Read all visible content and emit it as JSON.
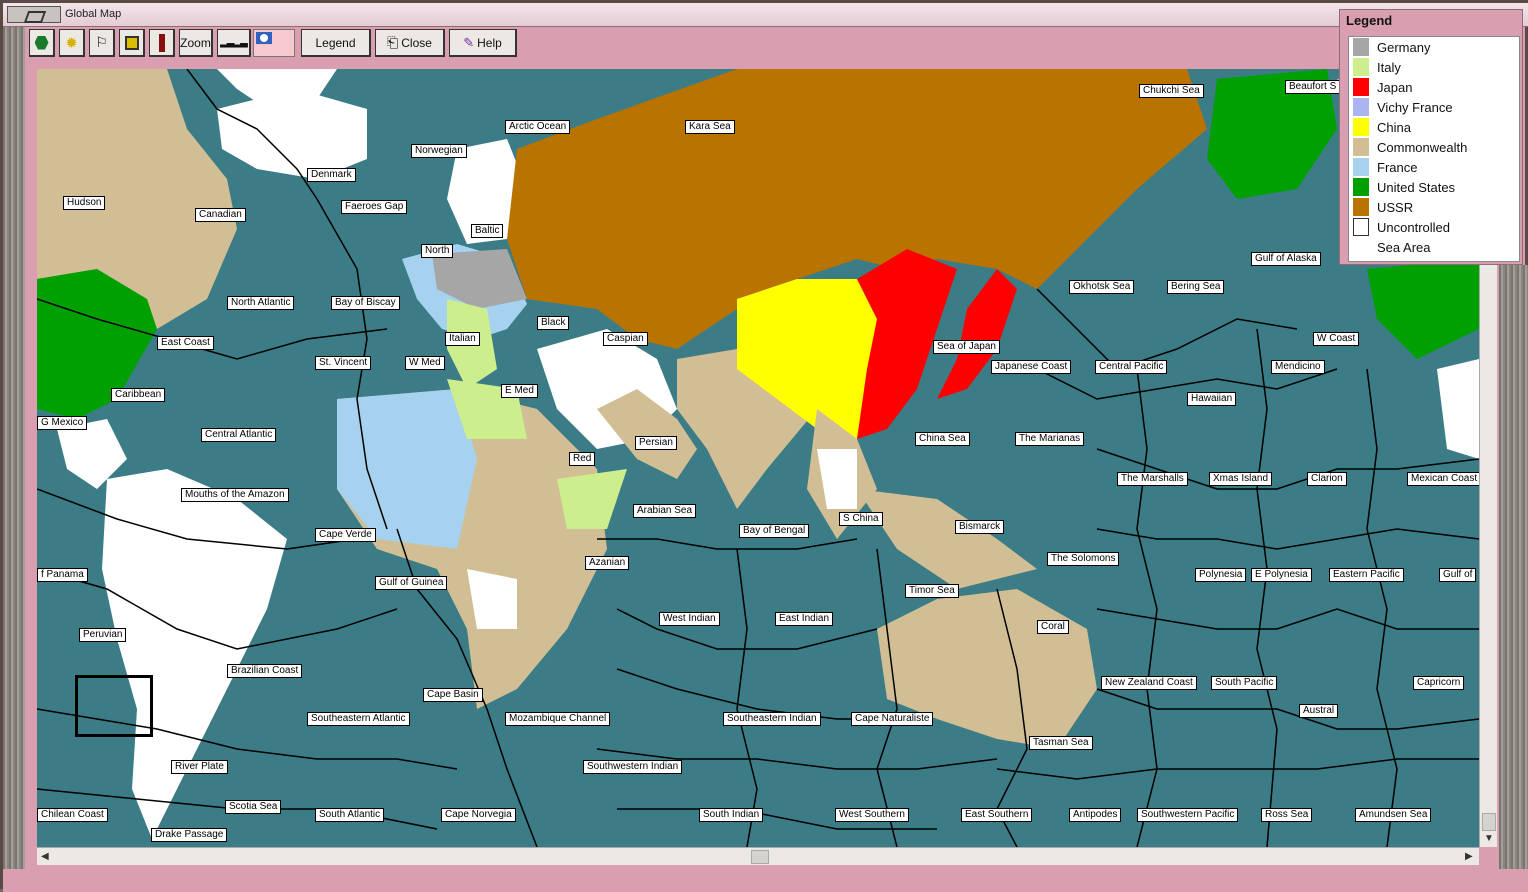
{
  "window": {
    "title": "Global Map"
  },
  "toolbar": {
    "zoom": "Zoom",
    "legend": "Legend",
    "close": "Close",
    "help": "Help"
  },
  "legend": {
    "title": "Legend",
    "items": [
      {
        "label": "Germany",
        "color": "#a6a6a6"
      },
      {
        "label": "Italy",
        "color": "#cdee8c"
      },
      {
        "label": "Japan",
        "color": "#ff0000"
      },
      {
        "label": "Vichy France",
        "color": "#a9b4f0"
      },
      {
        "label": "China",
        "color": "#ffff00"
      },
      {
        "label": "Commonwealth",
        "color": "#d2be94"
      },
      {
        "label": "France",
        "color": "#a6d2ef"
      },
      {
        "label": "United States",
        "color": "#00a000"
      },
      {
        "label": "USSR",
        "color": "#b97300"
      },
      {
        "label": "Uncontrolled",
        "color": "#ffffff"
      },
      {
        "label": "Sea Area",
        "color": "#3b7c86"
      }
    ]
  },
  "map": {
    "sea_color": "#3b7c86",
    "labels": [
      "Arctic Ocean",
      "Kara Sea",
      "Chukchi Sea",
      "Beaufort S",
      "Norwegian",
      "Denmark",
      "Hudson",
      "Faeroes Gap",
      "Canadian",
      "Baltic",
      "North",
      "Gulf of Alaska",
      "Okhotsk Sea",
      "Bering Sea",
      "North Atlantic",
      "Bay of Biscay",
      "Italian",
      "Black",
      "Caspian",
      "East Coast",
      "Sea of Japan",
      "W Coast",
      "St. Vincent",
      "W Med",
      "E Med",
      "Japanese Coast",
      "Central Pacific",
      "Mendicino",
      "Caribbean",
      "Hawaiian",
      "G Mexico",
      "Central Atlantic",
      "Persian",
      "China Sea",
      "The Marianas",
      "Red",
      "The Marshalls",
      "Xmas Island",
      "Clarion",
      "Mexican Coast",
      "Mouths of the Amazon",
      "Arabian Sea",
      "S China",
      "Bismarck",
      "Bay of Bengal",
      "Cape Verde",
      "Azanian",
      "The Solomons",
      "f Panama",
      "Polynesia",
      "E Polynesia",
      "Eastern Pacific",
      "Gulf of",
      "Gulf of Guinea",
      "Timor Sea",
      "West Indian",
      "East Indian",
      "Coral",
      "Peruvian",
      "Brazilian Coast",
      "New Zealand Coast",
      "South Pacific",
      "Capricorn",
      "Cape Basin",
      "Southeastern Atlantic",
      "Mozambique Channel",
      "Southeastern Indian",
      "Cape Naturaliste",
      "Austral",
      "Tasman Sea",
      "River Plate",
      "Southwestern Indian",
      "Scotia Sea",
      "South Atlantic",
      "Cape Norvegia",
      "South Indian",
      "West Southern",
      "East Southern",
      "Antipodes",
      "Southwestern Pacific",
      "Ross Sea",
      "Amundsen Sea",
      "Chilean Coast",
      "Drake Passage"
    ]
  }
}
